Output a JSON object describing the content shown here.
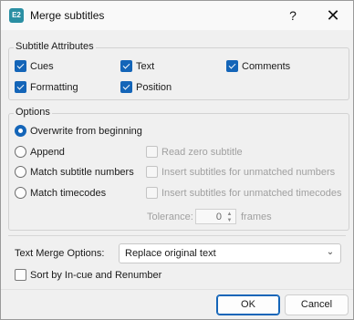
{
  "window": {
    "title": "Merge subtitles",
    "icon_label": "E2",
    "help": "?",
    "close": "✕"
  },
  "attributes": {
    "label": "Subtitle Attributes",
    "items": [
      {
        "label": "Cues",
        "checked": true
      },
      {
        "label": "Text",
        "checked": true
      },
      {
        "label": "Comments",
        "checked": true
      },
      {
        "label": "Formatting",
        "checked": true
      },
      {
        "label": "Position",
        "checked": true
      }
    ]
  },
  "options": {
    "label": "Options",
    "radios": [
      {
        "label": "Overwrite from beginning",
        "selected": true
      },
      {
        "label": "Append",
        "selected": false
      },
      {
        "label": "Match subtitle numbers",
        "selected": false
      },
      {
        "label": "Match timecodes",
        "selected": false
      }
    ],
    "checks": [
      {
        "label": "Read zero subtitle",
        "checked": false,
        "disabled": true
      },
      {
        "label": "Insert subtitles for unmatched numbers",
        "checked": false,
        "disabled": true
      },
      {
        "label": "Insert subtitles for unmatched timecodes",
        "checked": false,
        "disabled": true
      }
    ],
    "tolerance": {
      "label": "Tolerance:",
      "value": "0",
      "unit": "frames"
    }
  },
  "merge": {
    "label": "Text Merge Options:",
    "selected": "Replace original text",
    "sort_label": "Sort by In-cue and Renumber",
    "sort_checked": false
  },
  "buttons": {
    "ok": "OK",
    "cancel": "Cancel"
  },
  "colors": {
    "accent": "#1465b8",
    "app_icon": "#2a8fa3"
  }
}
